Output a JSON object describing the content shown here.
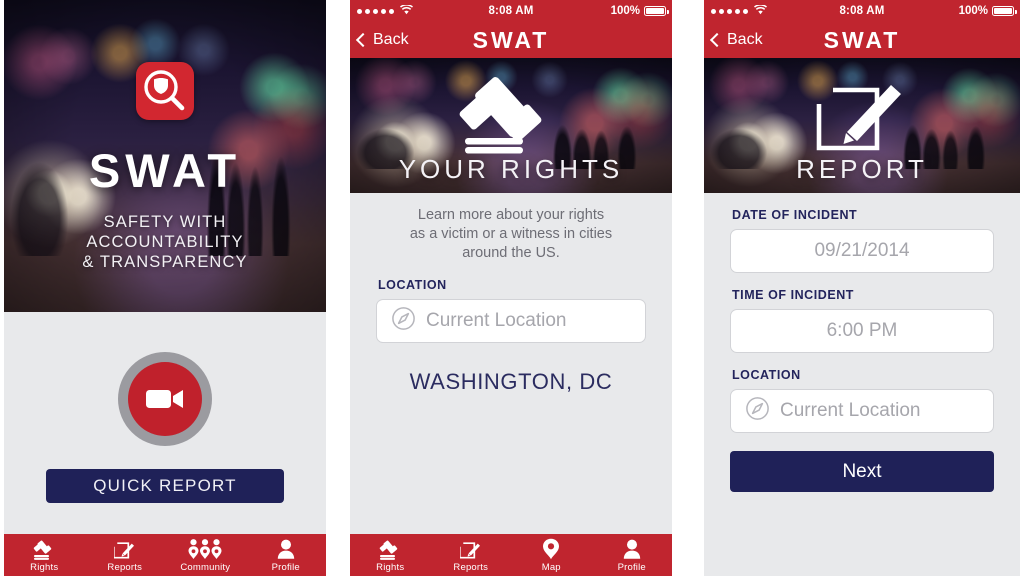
{
  "app": {
    "name": "SWAT",
    "accent_red": "#c0252f",
    "accent_navy": "#1f2158",
    "background_grey": "#e8e9eb"
  },
  "status_bar": {
    "signal_dots": 5,
    "wifi_icon": "wifi-icon",
    "time": "8:08 AM",
    "battery_percent": "100%",
    "battery_icon": "battery-full-icon"
  },
  "nav_bar": {
    "back_label": "Back",
    "back_icon": "chevron-left-icon",
    "title": "SWAT"
  },
  "screen_splash": {
    "logo_icon": "swat-badge-magnifier-icon",
    "title": "SWAT",
    "tagline_line1": "SAFETY WITH",
    "tagline_line2": "ACCOUNTABILITY",
    "tagline_line3": "& TRANSPARENCY",
    "record_icon": "video-camera-icon",
    "quick_report_label": "QUICK REPORT",
    "tabs": [
      {
        "label": "Rights",
        "icon": "gavel-icon"
      },
      {
        "label": "Reports",
        "icon": "pencil-square-icon"
      },
      {
        "label": "Community",
        "icon": "three-people-pins-icon"
      },
      {
        "label": "Profile",
        "icon": "person-icon"
      }
    ]
  },
  "screen_rights": {
    "hero_icon": "gavel-icon",
    "hero_label": "YOUR RIGHTS",
    "blurb_line1": "Learn more about your rights",
    "blurb_line2": "as a victim or a witness in cities",
    "blurb_line3": "around the US.",
    "location_label": "LOCATION",
    "location_placeholder": "Current Location",
    "location_icon": "compass-icon",
    "city_value": "WASHINGTON, DC",
    "tabs": [
      {
        "label": "Rights",
        "icon": "gavel-icon"
      },
      {
        "label": "Reports",
        "icon": "pencil-square-icon"
      },
      {
        "label": "Map",
        "icon": "map-pin-icon"
      },
      {
        "label": "Profile",
        "icon": "person-icon"
      }
    ]
  },
  "screen_report": {
    "hero_icon": "pencil-square-icon",
    "hero_label": "REPORT",
    "date_label": "DATE OF INCIDENT",
    "date_placeholder": "09/21/2014",
    "time_label": "TIME OF INCIDENT",
    "time_placeholder": "6:00 PM",
    "location_label": "LOCATION",
    "location_placeholder": "Current Location",
    "location_icon": "compass-icon",
    "next_label": "Next"
  }
}
